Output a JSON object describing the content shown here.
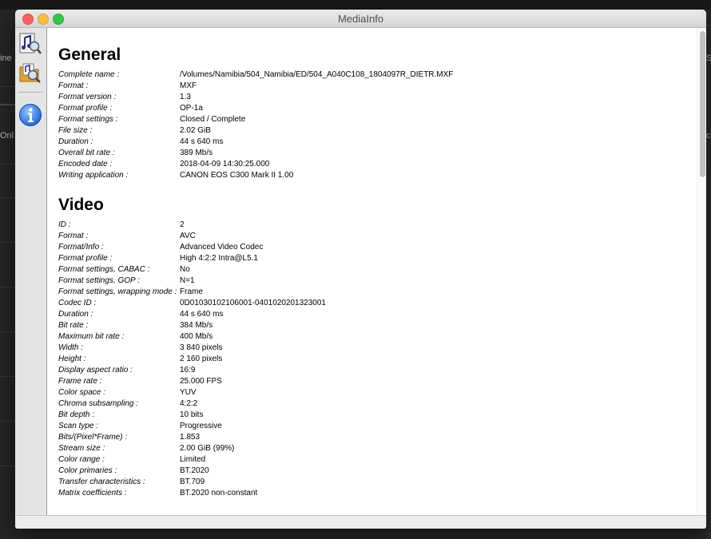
{
  "window": {
    "title": "MediaInfo"
  },
  "background": {
    "left_labels": [
      "ine",
      "Onl"
    ],
    "right_labels": [
      "S",
      "c"
    ]
  },
  "toolbar": {
    "items": [
      {
        "icon": "media-file-icon"
      },
      {
        "icon": "folder-media-icon"
      },
      {
        "icon": "info-icon"
      }
    ]
  },
  "general": {
    "title": "General",
    "rows": [
      {
        "key": "Complete name :",
        "value": "/Volumes/Namibia/504_Namibia/ED/504_A040C108_1804097R_DIETR.MXF"
      },
      {
        "key": "Format :",
        "value": "MXF"
      },
      {
        "key": "Format version :",
        "value": "1.3"
      },
      {
        "key": "Format profile :",
        "value": "OP-1a"
      },
      {
        "key": "Format settings :",
        "value": "Closed / Complete"
      },
      {
        "key": "File size :",
        "value": "2.02 GiB"
      },
      {
        "key": "Duration :",
        "value": "44 s 640 ms"
      },
      {
        "key": "Overall bit rate :",
        "value": "389 Mb/s"
      },
      {
        "key": "Encoded date :",
        "value": "2018-04-09 14:30:25.000"
      },
      {
        "key": "Writing application :",
        "value": "CANON EOS C300 Mark II 1.00"
      }
    ]
  },
  "video": {
    "title": "Video",
    "rows": [
      {
        "key": "ID :",
        "value": "2"
      },
      {
        "key": "Format :",
        "value": "AVC"
      },
      {
        "key": "Format/Info :",
        "value": "Advanced Video Codec"
      },
      {
        "key": "Format profile :",
        "value": "High 4:2:2 Intra@L5.1"
      },
      {
        "key": "Format settings, CABAC :",
        "value": "No"
      },
      {
        "key": "Format settings, GOP :",
        "value": "N=1"
      },
      {
        "key": "Format settings, wrapping mode :",
        "value": "Frame"
      },
      {
        "key": "Codec ID :",
        "value": "0D01030102106001-0401020201323001"
      },
      {
        "key": "Duration :",
        "value": "44 s 640 ms"
      },
      {
        "key": "Bit rate :",
        "value": "384 Mb/s"
      },
      {
        "key": "Maximum bit rate :",
        "value": "400 Mb/s"
      },
      {
        "key": "Width :",
        "value": "3 840 pixels"
      },
      {
        "key": "Height :",
        "value": "2 160 pixels"
      },
      {
        "key": "Display aspect ratio :",
        "value": "16:9"
      },
      {
        "key": "Frame rate :",
        "value": "25.000 FPS"
      },
      {
        "key": "Color space :",
        "value": "YUV"
      },
      {
        "key": "Chroma subsampling :",
        "value": "4:2:2"
      },
      {
        "key": "Bit depth :",
        "value": "10 bits"
      },
      {
        "key": "Scan type :",
        "value": "Progressive"
      },
      {
        "key": "Bits/(Pixel*Frame) :",
        "value": "1.853"
      },
      {
        "key": "Stream size :",
        "value": "2.00 GiB (99%)"
      },
      {
        "key": "Color range :",
        "value": "Limited"
      },
      {
        "key": "Color primaries :",
        "value": "BT.2020"
      },
      {
        "key": "Transfer characteristics :",
        "value": "BT.709"
      },
      {
        "key": "Matrix coefficients :",
        "value": "BT.2020 non-constant"
      }
    ]
  }
}
